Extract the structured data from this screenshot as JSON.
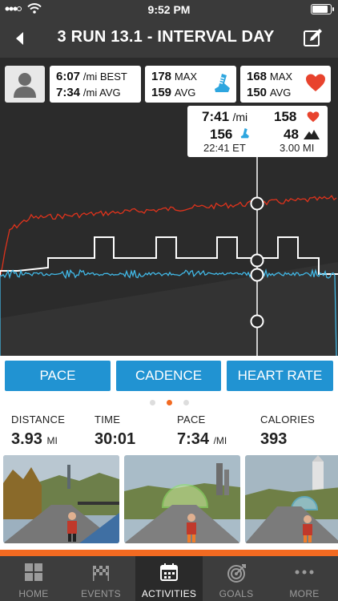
{
  "status": {
    "time": "9:52 PM",
    "battery_level": 0.85
  },
  "header": {
    "title": "3 RUN 13.1 - INTERVAL DAY"
  },
  "stats": {
    "pace": {
      "best_value": "6:07",
      "best_label": "/mi BEST",
      "avg_value": "7:34",
      "avg_label": "/mi AVG"
    },
    "cadence": {
      "max_value": "178",
      "max_label": "MAX",
      "avg_value": "159",
      "avg_label": "AVG"
    },
    "heart": {
      "max_value": "168",
      "max_label": "MAX",
      "avg_value": "150",
      "avg_label": "AVG"
    }
  },
  "tooltip": {
    "pace": "7:41",
    "pace_unit": "/mi",
    "heart_rate": "158",
    "cadence": "156",
    "elevation": "48",
    "elapsed": "22:41 ET",
    "distance": "3.00 MI"
  },
  "chart_tabs": [
    "PACE",
    "CADENCE",
    "HEART RATE"
  ],
  "pager": {
    "count": 3,
    "active": 1
  },
  "summary": {
    "distance_label": "DISTANCE",
    "distance_value": "3.93",
    "distance_unit": "MI",
    "time_label": "TIME",
    "time_value": "30:01",
    "pace_label": "PACE",
    "pace_value": "7:34",
    "pace_unit": "/MI",
    "calories_label": "CALORIES",
    "calories_value": "393"
  },
  "nav": [
    {
      "label": "HOME",
      "icon": "grid-icon",
      "active": false
    },
    {
      "label": "EVENTS",
      "icon": "checkered-flag-icon",
      "active": false
    },
    {
      "label": "ACTIVITIES",
      "icon": "calendar-icon",
      "active": true
    },
    {
      "label": "GOALS",
      "icon": "target-icon",
      "active": false
    },
    {
      "label": "MORE",
      "icon": "more-dots-icon",
      "active": false
    }
  ],
  "colors": {
    "accent": "#f26a21",
    "tab_blue": "#2193d2",
    "heart_red": "#e8432d",
    "cadence_blue": "#2ea6df",
    "hr_line": "#e0331c",
    "cad_line": "#41b8e6"
  }
}
